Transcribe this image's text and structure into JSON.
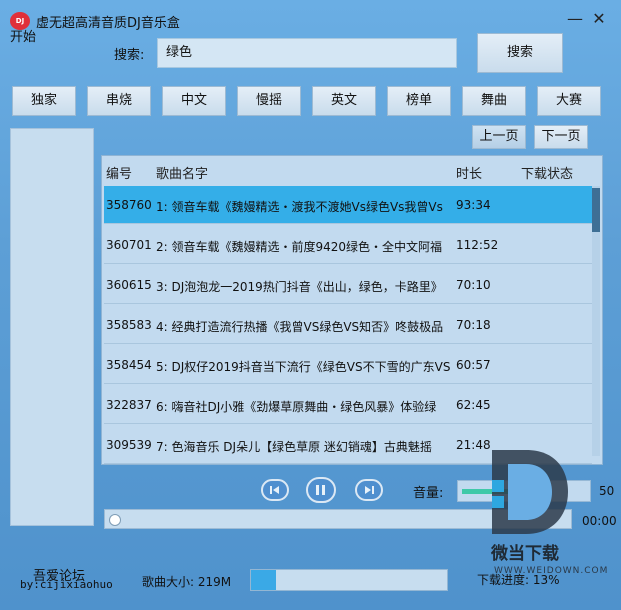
{
  "app": {
    "logo_text": "DJ",
    "title": "虚无超高清音质DJ音乐盒",
    "start_label": "开始",
    "minimize_glyph": "—",
    "close_glyph": "✕"
  },
  "search": {
    "label": "搜索:",
    "value": "绿色",
    "button_label": "搜索"
  },
  "categories": [
    "独家",
    "串烧",
    "中文",
    "慢摇",
    "英文",
    "榜单",
    "舞曲",
    "大赛"
  ],
  "paging": {
    "prev_label": "上一页",
    "next_label": "下一页"
  },
  "table": {
    "headers": {
      "id": "编号",
      "name": "歌曲名字",
      "duration": "时长",
      "status": "下载状态"
    },
    "rows": [
      {
        "id": "358760",
        "name": "1: 领音车载《魏嫚精选・渡我不渡她Vs绿色Vs我曾Vs",
        "duration": "93:34",
        "selected": true
      },
      {
        "id": "360701",
        "name": "2: 领音车载《魏嫚精选・前度9420绿色・全中文阿福",
        "duration": "112:52",
        "selected": false
      },
      {
        "id": "360615",
        "name": "3: DJ泡泡龙一2019热门抖音《出山，绿色，卡路里》",
        "duration": "70:10",
        "selected": false
      },
      {
        "id": "358583",
        "name": "4: 经典打造流行热播《我曾VS绿色VS知否》咚鼓极品",
        "duration": "70:18",
        "selected": false
      },
      {
        "id": "358454",
        "name": "5: DJ权仔2019抖音当下流行《绿色VS不下雪的广东VS",
        "duration": "60:57",
        "selected": false
      },
      {
        "id": "322837",
        "name": "6: 嗨音社DJ小雅《劲爆草原舞曲・绿色风暴》体验绿",
        "duration": "62:45",
        "selected": false
      },
      {
        "id": "309539",
        "name": "7: 色海音乐 DJ朵儿【绿色草原 迷幻销魂】古典魅摇",
        "duration": "21:48",
        "selected": false
      }
    ]
  },
  "player": {
    "prev_icon": "skip-back-icon",
    "play_icon": "pause-icon",
    "next_icon": "skip-forward-icon",
    "volume_label": "音量:",
    "volume_value": "50",
    "volume_level": 0.5,
    "progress": 0,
    "time": "00:00"
  },
  "footer": {
    "forum": "吾爱论坛",
    "by": "by:cijixiaohuo",
    "size_label": "歌曲大小: 219M",
    "download_progress_label": "下载进度: 13%",
    "download_progress": 0.13
  },
  "watermark": {
    "text": "微当下载",
    "url": "WWW.WEIDOWN.COM"
  },
  "colors": {
    "window_bg": "#5d9fd6",
    "selected_row": "#34aee8",
    "volume_fill": "#3fc9a8"
  }
}
